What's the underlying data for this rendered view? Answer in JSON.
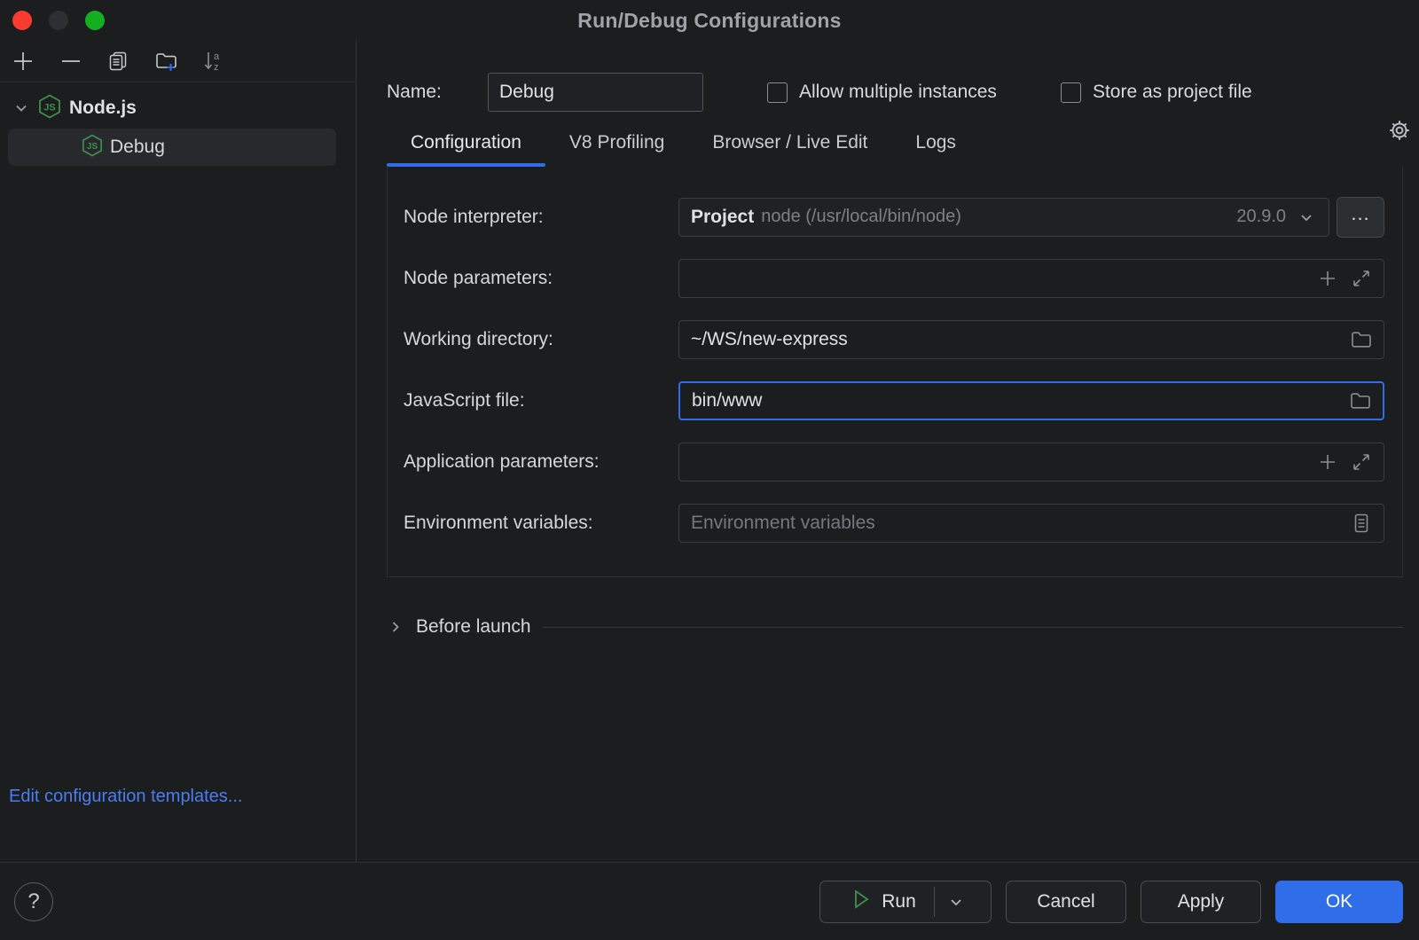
{
  "window": {
    "title": "Run/Debug Configurations",
    "traffic": {
      "close": "close-button",
      "minimize": "minimize-button",
      "maximize": "maximize-button"
    }
  },
  "sidebar": {
    "toolbar": [
      {
        "name": "add-configuration-button",
        "icon": "plus-icon",
        "label": "+"
      },
      {
        "name": "remove-configuration-button",
        "icon": "minus-icon",
        "label": "—"
      },
      {
        "name": "copy-configuration-button",
        "icon": "copy-icon",
        "label": ""
      },
      {
        "name": "new-folder-button",
        "icon": "folder-add-icon",
        "label": ""
      },
      {
        "name": "sort-alphabetically-button",
        "icon": "sort-az-icon",
        "label": ""
      }
    ],
    "tree": {
      "group": {
        "label": "Node.js",
        "icon": "nodejs-icon",
        "expanded": true
      },
      "items": [
        {
          "label": "Debug",
          "icon": "nodejs-icon",
          "selected": true
        }
      ]
    },
    "edit_templates_link": "Edit configuration templates..."
  },
  "main": {
    "name_label": "Name:",
    "name_value": "Debug",
    "checkboxes": [
      {
        "label": "Allow multiple instances",
        "checked": false
      },
      {
        "label": "Store as project file",
        "checked": false
      }
    ],
    "settings_gear": "gear-icon",
    "tabs": [
      {
        "label": "Configuration",
        "active": true
      },
      {
        "label": "V8 Profiling",
        "active": false
      },
      {
        "label": "Browser / Live Edit",
        "active": false
      },
      {
        "label": "Logs",
        "active": false
      }
    ],
    "fields": {
      "node_interpreter": {
        "label": "Node interpreter:",
        "scope": "Project",
        "path": "node (/usr/local/bin/node)",
        "version": "20.9.0",
        "browse_label": "..."
      },
      "node_parameters": {
        "label": "Node parameters:",
        "value": "",
        "placeholder": ""
      },
      "working_directory": {
        "label": "Working directory:",
        "value": "~/WS/new-express"
      },
      "javascript_file": {
        "label": "JavaScript file:",
        "value": "bin/www",
        "focused": true
      },
      "application_parameters": {
        "label": "Application parameters:",
        "value": "",
        "placeholder": ""
      },
      "environment_variables": {
        "label": "Environment variables:",
        "value": "",
        "placeholder": "Environment variables"
      }
    },
    "before_launch": {
      "label": "Before launch",
      "expanded": false
    }
  },
  "footer": {
    "help_label": "?",
    "buttons": [
      {
        "label": "Run",
        "name": "run-button",
        "kind": "split"
      },
      {
        "label": "Cancel",
        "name": "cancel-button",
        "kind": "normal"
      },
      {
        "label": "Apply",
        "name": "apply-button",
        "kind": "normal"
      },
      {
        "label": "OK",
        "name": "ok-button",
        "kind": "primary"
      }
    ]
  },
  "colors": {
    "background": "#1b1d1f",
    "accent": "#2f6ee8",
    "link": "#4a7ef0",
    "node_green": "#3f8f4b",
    "run_green": "#3f8f4b",
    "close_red": "#fb3b30",
    "maximize_green": "#14ae21"
  }
}
